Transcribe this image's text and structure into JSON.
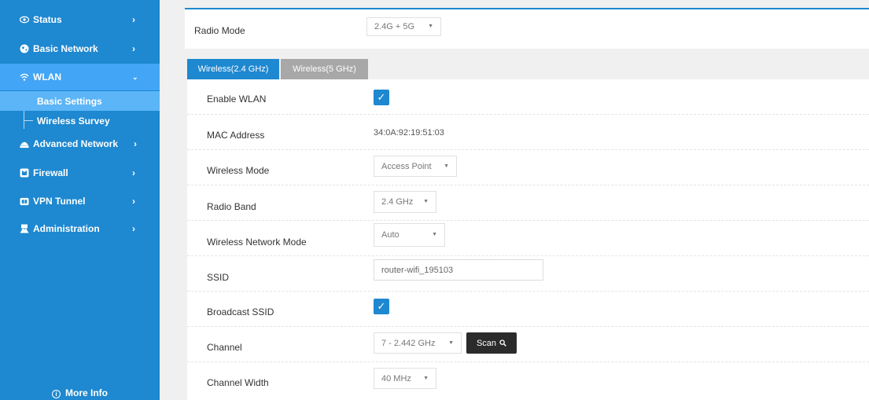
{
  "sidebar": {
    "items": [
      {
        "label": "Status",
        "icon": "eye-icon"
      },
      {
        "label": "Basic Network",
        "icon": "globe-icon"
      },
      {
        "label": "WLAN",
        "icon": "wifi-icon"
      },
      {
        "label": "Advanced Network",
        "icon": "network-icon"
      },
      {
        "label": "Firewall",
        "icon": "firewall-icon"
      },
      {
        "label": "VPN Tunnel",
        "icon": "vpn-icon"
      },
      {
        "label": "Administration",
        "icon": "admin-icon"
      }
    ],
    "wlan_sub": [
      {
        "label": "Basic Settings"
      },
      {
        "label": "Wireless Survey"
      }
    ],
    "more_info": "More Info"
  },
  "radio_mode": {
    "label": "Radio Mode",
    "value": "2.4G + 5G"
  },
  "tabs": [
    {
      "label": "Wireless(2.4 GHz)"
    },
    {
      "label": "Wireless(5 GHz)"
    }
  ],
  "settings": {
    "enable_wlan": {
      "label": "Enable WLAN",
      "checked": "✓"
    },
    "mac_address": {
      "label": "MAC Address",
      "value": "34:0A:92:19:51:03"
    },
    "wireless_mode": {
      "label": "Wireless Mode",
      "value": "Access Point"
    },
    "radio_band": {
      "label": "Radio Band",
      "value": "2.4 GHz"
    },
    "network_mode": {
      "label": "Wireless Network Mode",
      "value": "Auto"
    },
    "ssid": {
      "label": "SSID",
      "value": "router-wifi_195103"
    },
    "broadcast_ssid": {
      "label": "Broadcast SSID",
      "checked": "✓"
    },
    "channel": {
      "label": "Channel",
      "value": "7 - 2.442 GHz",
      "scan_label": "Scan"
    },
    "channel_width": {
      "label": "Channel Width",
      "value": "40 MHz"
    }
  },
  "colors": {
    "accent": "#1e88d0",
    "active_nav": "#42a5f5",
    "inactive_tab": "#a8a8a8"
  }
}
